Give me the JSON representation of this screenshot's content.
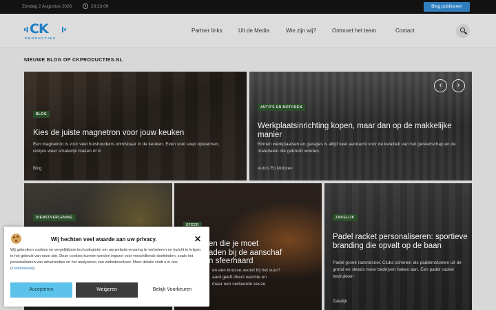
{
  "topbar": {
    "date": "Zondag 2 Augustus 2026",
    "time": "23:23:09",
    "publish_button": "Blog publiceren"
  },
  "logo": {
    "word": "CK",
    "sub": "PRODUCTIES"
  },
  "nav": {
    "items": [
      "Partner links",
      "Uit de Media",
      "Wie zijn wij?",
      "Ontmoet het team",
      "Contact"
    ]
  },
  "section": {
    "title": "NIEUWE BLOG OP CKPRODUCTIES.NL"
  },
  "slider": {
    "prev": "‹",
    "next": "›"
  },
  "cards": [
    {
      "badge": "Blog",
      "title": "Kies de juiste magnetron voor jouw keuken",
      "excerpt": "Een magnetron is voor veel huishoudens onmisbaar in de keuken. Even snel soep opwarmen, restjes weer smakelijk maken of in",
      "category": "Blog"
    },
    {
      "badge": "Auto's en Motoren",
      "title": "Werkplaatsinrichting kopen, maar dan op de makkelijke manier",
      "excerpt": "Binnen werkplaatsen en garages is altijd veel aandacht voor de kwaliteit van het gereedschap en de materialen die gebruikt worden.",
      "category": "Auto's En Motoren"
    },
    {
      "badge": "Dienstverlening",
      "title": "",
      "excerpt": "",
      "category": ""
    },
    {
      "badge": "Sfeer",
      "title": "Waarom je moet letten bij de aanschaf van een sfeerhaard",
      "title_lines": [
        "en die je moet",
        "aden bij de aanschaf",
        "n sfeerhaard"
      ],
      "excerpt_lines": [
        "en een knusse avond bij het vuur?",
        "aard geeft direct warmte en",
        "maar een verkeerde keuze"
      ],
      "category": ""
    },
    {
      "badge": "Zakelijk",
      "title": "Padel racket personaliseren: sportieve branding die opvalt op de baan",
      "excerpt": "Padel groeit razendsnel. Clubs schieten als paddenstoelen uit de grond en steeds meer bedrijven haken aan. Een padel racket bedrukken",
      "category": "Zakelijk"
    }
  ],
  "cookie": {
    "heading": "Wij hechten veel waarde aan uw privacy.",
    "close": "✕",
    "body": "Wij gebruiken cookies en vergelijkbare technologieën om uw website-ervaring te verbeteren en inzicht te krijgen in het gebruik van onze site. Deze cookies kunnen worden ingezet voor verschillende doeleinden, zoals het personaliseren van advertenties en het analyseren van websiteverkeer. Meer details vindt u in ons",
    "link": "cookiebeleid",
    "accept": "Accepteren",
    "decline": "Weigeren",
    "preferences": "Bekijk Voorkeuren"
  },
  "colors": {
    "accent": "#2f7fbf",
    "badge": "#2a4e2a",
    "accept": "#5bc2ea"
  }
}
